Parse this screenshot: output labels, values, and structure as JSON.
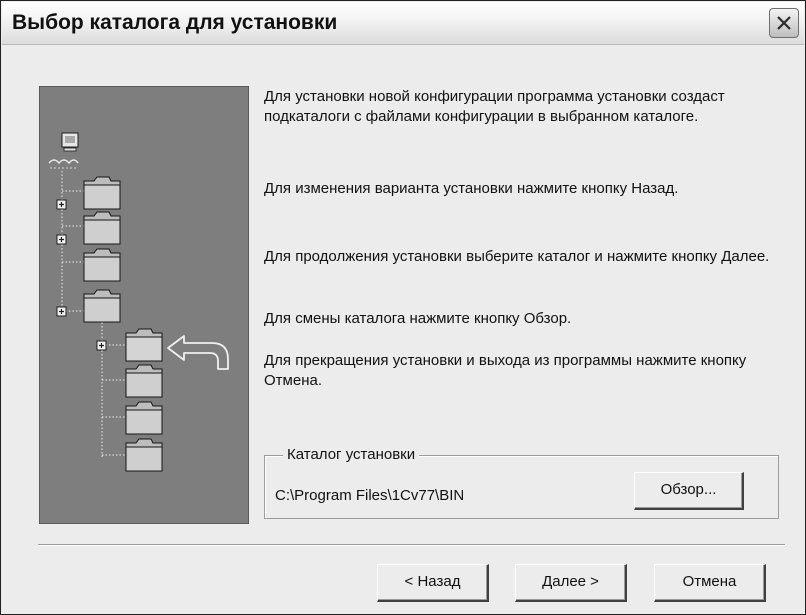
{
  "window": {
    "title": "Выбор каталога для установки"
  },
  "instructions": [
    "Для установки новой конфигурации программа установки создаст подкаталоги с файлами конфигурации в выбранном каталоге.",
    "Для изменения варианта установки нажмите кнопку Назад.",
    "Для продолжения установки выберите каталог и нажмите кнопку Далее.",
    "Для смены каталога нажмите кнопку Обзор.",
    "Для прекращения установки и выхода из программы нажмите кнопку Отмена."
  ],
  "install_dir": {
    "label": "Каталог установки",
    "path": "C:\\Program Files\\1Cv77\\BIN",
    "browse_label": "Обзор..."
  },
  "footer": {
    "back_label": "< Назад",
    "next_label": "Далее >",
    "cancel_label": "Отмена"
  },
  "icons": {
    "close": "close-icon",
    "computer": "computer-icon",
    "folder": "folder-icon",
    "expand": "plus-box-icon",
    "arrow": "arrow-left-icon"
  }
}
